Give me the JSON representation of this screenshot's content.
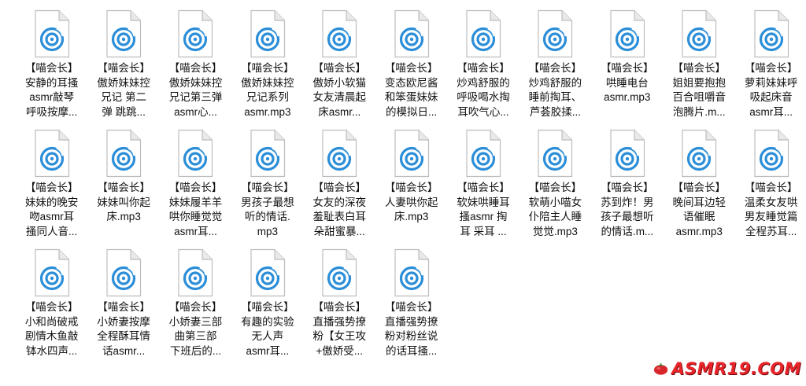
{
  "icons": {
    "file": "music-file-icon",
    "watermark_logo": "tomato-logo"
  },
  "colors": {
    "icon_accent": "#2b8ed8",
    "page_fold": "#d7d7d7",
    "watermark": "#e8252a"
  },
  "files": [
    {
      "name": "【喵会长】\n安静的耳搔\nasmr敲琴\n呼吸按摩..."
    },
    {
      "name": "【喵会长】\n傲娇妹妹控\n兄记 第二\n弹 跳跳..."
    },
    {
      "name": "【喵会长】\n傲娇妹妹控\n兄记第三弹\nasmr心..."
    },
    {
      "name": "【喵会长】\n傲娇妹妹控\n兄记系列\nasmr.mp3"
    },
    {
      "name": "【喵会长】\n傲娇小软猫\n女友清晨起\n床asmr..."
    },
    {
      "name": "【喵会长】\n变态欧尼酱\n和笨蛋妹妹\n的模拟日..."
    },
    {
      "name": "【喵会长】\n炒鸡舒服的\n呼吸喝水掏\n耳吹气心..."
    },
    {
      "name": "【喵会长】\n炒鸡舒服的\n睡前掏耳、\n芦荟胶揉..."
    },
    {
      "name": "【喵会长】\n哄睡电台\nasmr.mp3"
    },
    {
      "name": "【喵会长】\n姐姐要抱抱\n百合咀嚼音\n泡腾片.m..."
    },
    {
      "name": "【喵会长】\n萝莉妹妹呼\n吸起床音\nasmr耳..."
    },
    {
      "name": "【喵会长】\n妹妹的晚安\n吻asmr耳\n搔同人音..."
    },
    {
      "name": "【喵会长】\n妹妹叫你起\n床.mp3"
    },
    {
      "name": "【喵会长】\n妹妹履羊羊\n哄你睡觉觉\nasmr耳..."
    },
    {
      "name": "【喵会长】\n男孩子最想\n听的情话.\nmp3"
    },
    {
      "name": "【喵会长】\n女友的深夜\n羞耻表白耳\n朵甜蜜暴..."
    },
    {
      "name": "【喵会长】\n人妻哄你起\n床.mp3"
    },
    {
      "name": "【喵会长】\n软妹哄睡耳\n搔asmr 掏\n耳 采耳 ..."
    },
    {
      "name": "【喵会长】\n软萌小喵女\n仆陪主人睡\n觉觉.mp3"
    },
    {
      "name": "【喵会长】\n苏到炸！男\n孩子最想听\n的情话.m..."
    },
    {
      "name": "【喵会长】\n晚间耳边轻\n语催眠\nasmr.mp3"
    },
    {
      "name": "【喵会长】\n温柔女友哄\n男友睡觉篇\n全程苏耳..."
    },
    {
      "name": "【喵会长】\n小和尚破戒\n剧情木鱼敲\n钵水四声..."
    },
    {
      "name": "【喵会长】\n小娇妻按摩\n全程酥耳情\n话asmr..."
    },
    {
      "name": "【喵会长】\n小娇妻三部\n曲第三部\n下班后的..."
    },
    {
      "name": "【喵会长】\n有趣的实验\n无人声\nasmr耳..."
    },
    {
      "name": "【喵会长】\n直播强势撩\n粉【女王攻\n+傲娇受..."
    },
    {
      "name": "【喵会长】\n直播强势撩\n粉对粉丝说\n的话耳搔..."
    }
  ],
  "watermark": {
    "text": "ASMR19.COM"
  }
}
